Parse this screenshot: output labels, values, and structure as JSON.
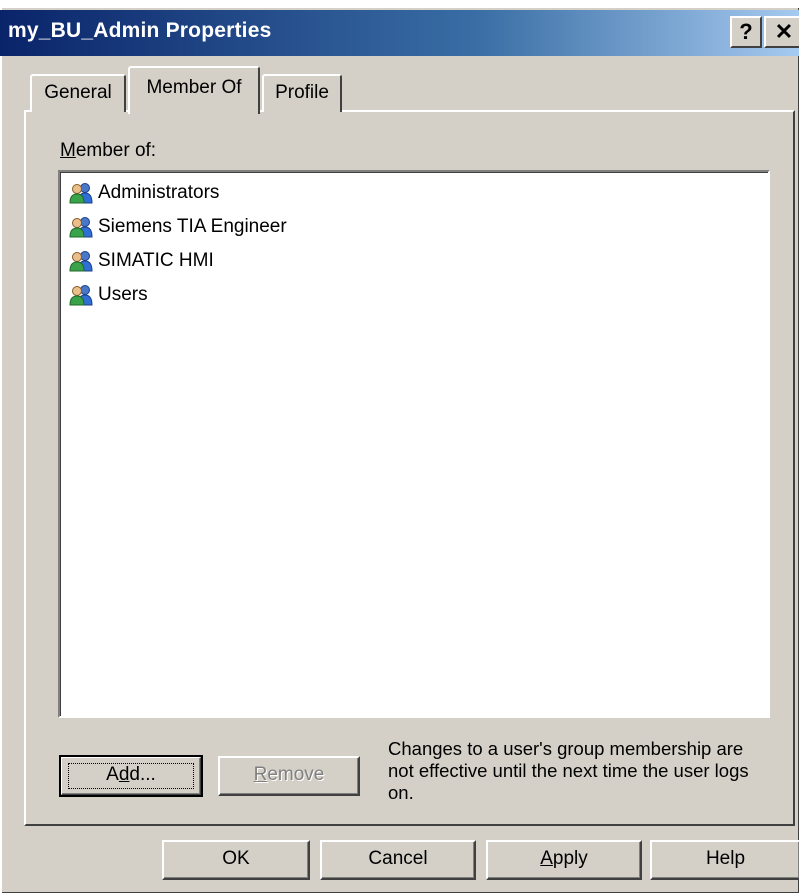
{
  "window": {
    "title": "my_BU_Admin Properties",
    "help_glyph": "?",
    "close_glyph": "✕"
  },
  "tabs": [
    {
      "label": "General",
      "active": false
    },
    {
      "label": "Member Of",
      "active": true
    },
    {
      "label": "Profile",
      "active": false
    }
  ],
  "member_of": {
    "label_mnemonic": "M",
    "label_rest": "ember of:",
    "groups": [
      {
        "name": "Administrators",
        "icon": "group-icon"
      },
      {
        "name": "Siemens TIA Engineer",
        "icon": "group-icon"
      },
      {
        "name": "SIMATIC HMI",
        "icon": "group-icon"
      },
      {
        "name": "Users",
        "icon": "group-icon"
      }
    ]
  },
  "buttons": {
    "add_pre": "A",
    "add_mnemonic": "d",
    "add_post": "d...",
    "remove_mnemonic": "R",
    "remove_post": "emove",
    "ok": "OK",
    "cancel": "Cancel",
    "apply_mnemonic": "A",
    "apply_post": "pply",
    "help": "Help"
  },
  "note": "Changes to a user's group membership are not effective until the next time the user logs on.",
  "colors": {
    "titlebar_start": "#0a246a",
    "titlebar_end": "#a6caf0",
    "face": "#d4d0c8"
  }
}
